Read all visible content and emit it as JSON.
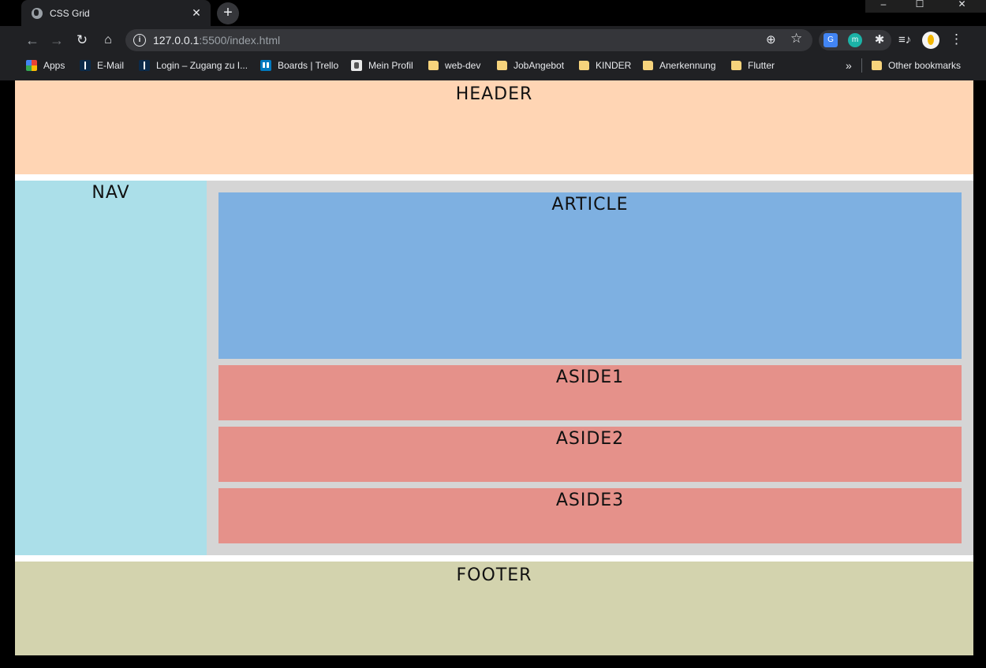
{
  "browser": {
    "tab_title": "CSS Grid",
    "tab_close": "✕",
    "new_tab": "+",
    "window_controls": {
      "minimize": "–",
      "maximize": "☐",
      "close": "✕"
    },
    "url_host": "127.0.0.1",
    "url_rest": ":5500/index.html",
    "bookmarks": [
      {
        "label": "Apps",
        "icon": "apps-icon"
      },
      {
        "label": "E-Mail",
        "icon": "ionos-icon"
      },
      {
        "label": "Login – Zugang zu I...",
        "icon": "ionos-icon"
      },
      {
        "label": "Boards | Trello",
        "icon": "trello-icon"
      },
      {
        "label": "Mein Profil",
        "icon": "crest-icon"
      },
      {
        "label": "web-dev",
        "icon": "folder-icon"
      },
      {
        "label": "JobAngebot",
        "icon": "folder-icon"
      },
      {
        "label": "KINDER",
        "icon": "folder-icon"
      },
      {
        "label": "Anerkennung",
        "icon": "folder-icon"
      },
      {
        "label": "Flutter",
        "icon": "folder-icon"
      }
    ],
    "overflow": "»",
    "other_bookmarks": "Other bookmarks",
    "extensions": {
      "m_label": "m"
    }
  },
  "page": {
    "header": "HEADER",
    "nav": "NAV",
    "article": "ARTICLE",
    "aside1": "ASIDE1",
    "aside2": "ASIDE2",
    "aside3": "ASIDE3",
    "footer": "FOOTER"
  },
  "colors": {
    "header": "#ffd5b4",
    "nav": "#abdfe9",
    "main": "#d5d5d5",
    "article": "#7eb0e1",
    "aside": "#e5918a",
    "footer": "#d3d3ae"
  }
}
